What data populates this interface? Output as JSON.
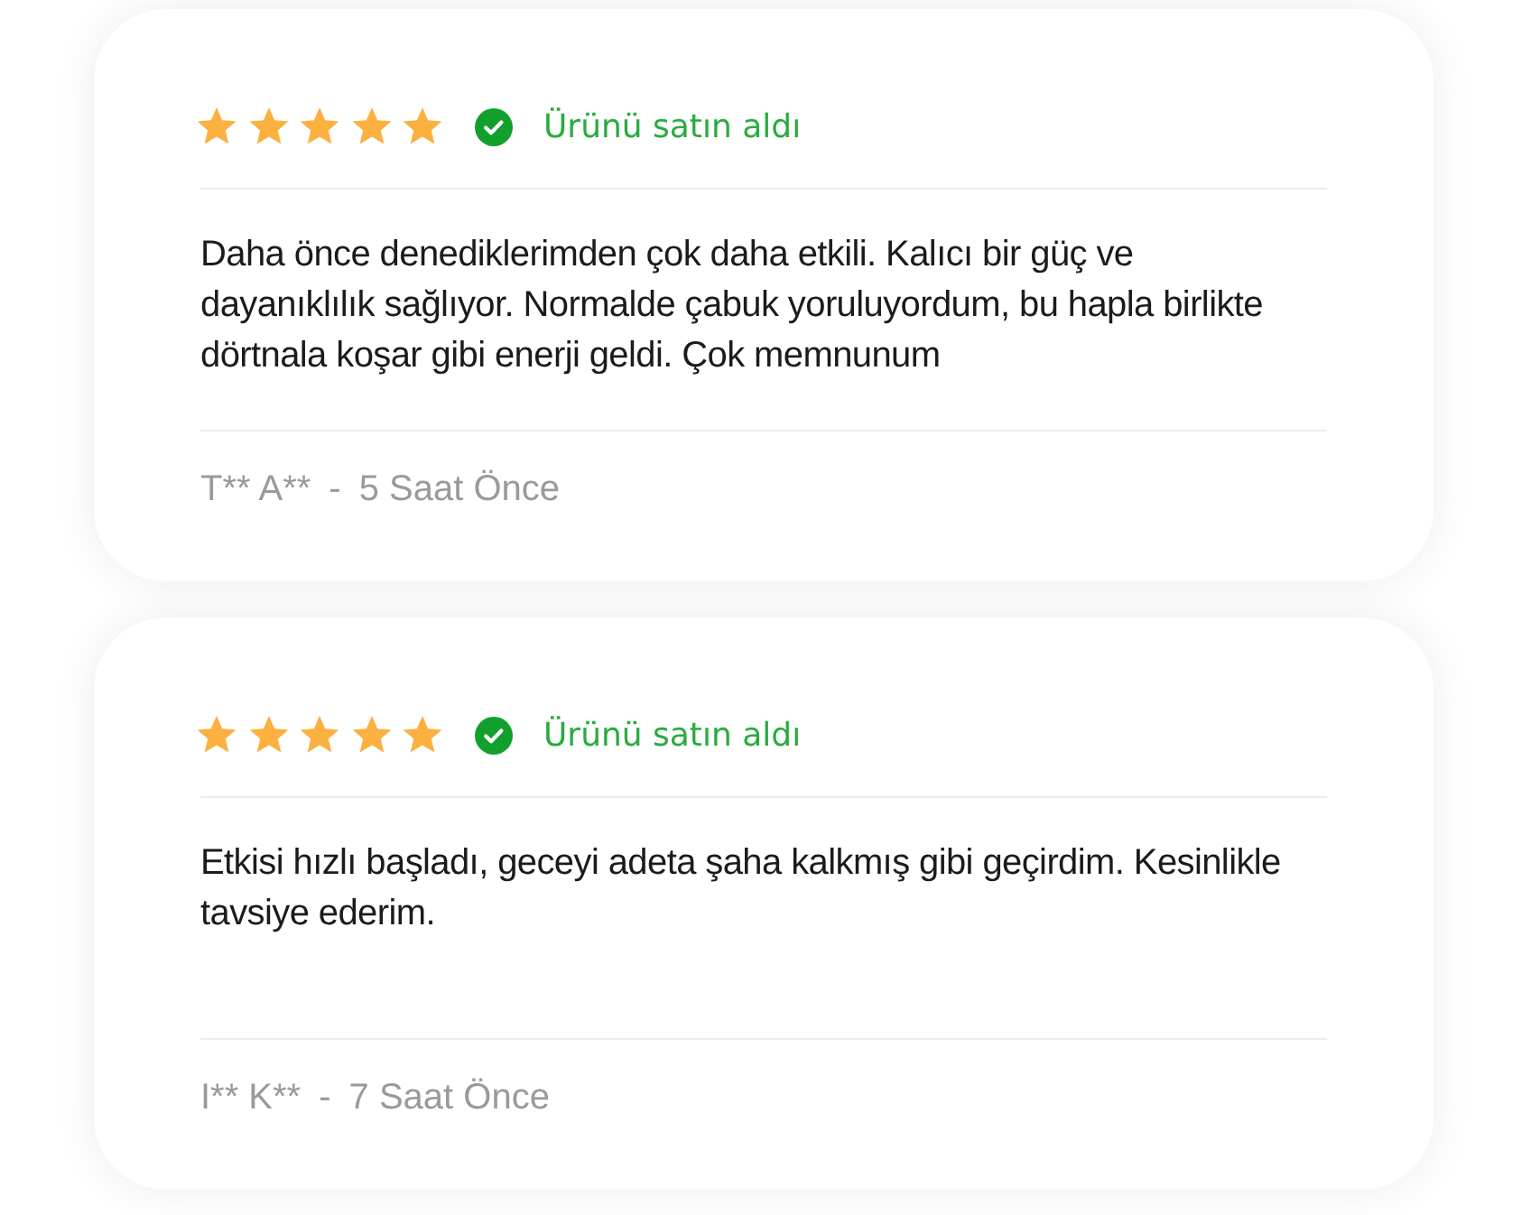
{
  "reviews": [
    {
      "stars": 5,
      "verified": true,
      "verified_label": "Ürünü satın aldı",
      "text": "Daha önce denediklerimden çok daha etkili. Kalıcı bir güç ve dayanıklılık sağlıyor. Normalde çabuk yoruluyordum, bu hapla birlikte dörtnala koşar gibi enerji geldi. Çok memnunum",
      "author": "T** A**",
      "separator": "-",
      "time": "5 Saat Önce"
    },
    {
      "stars": 5,
      "verified": true,
      "verified_label": "Ürünü satın aldı",
      "text": "Etkisi hızlı başladı, geceyi adeta şaha kalkmış gibi geçirdim. Kesinlikle tavsiye ederim.",
      "author": "I** K**",
      "separator": "-",
      "time": "7 Saat Önce"
    }
  ]
}
